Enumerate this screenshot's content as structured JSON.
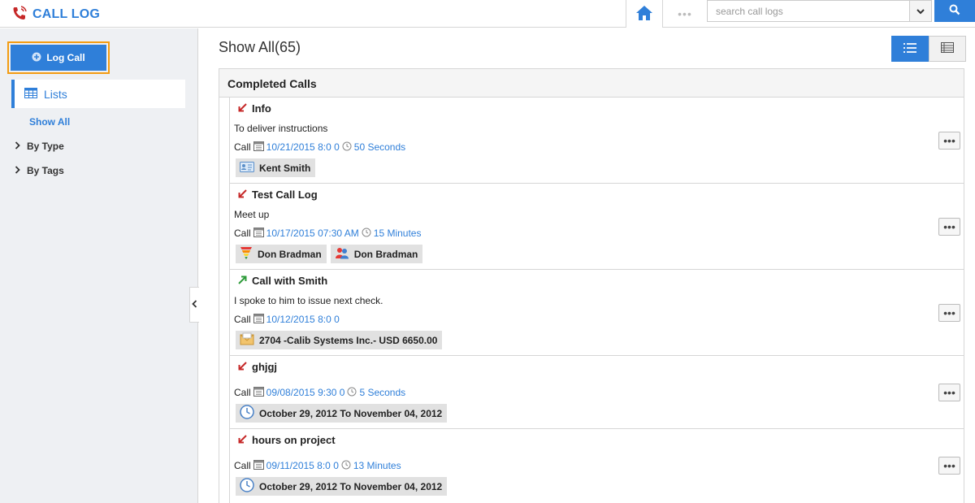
{
  "header": {
    "title": "CALL LOG",
    "search_placeholder": "search call logs",
    "dots": "•••"
  },
  "sidebar": {
    "log_call_label": "Log Call",
    "lists_label": "Lists",
    "show_all_label": "Show All",
    "by_type_label": "By Type",
    "by_tags_label": "By Tags"
  },
  "main": {
    "title": "Show All(65)",
    "panel_title": "Completed Calls",
    "more_label": "•••",
    "rows": [
      {
        "title": "Info",
        "direction": "incoming",
        "description": "To deliver instructions",
        "type": "Call",
        "datetime": "10/21/2015 8:0 0",
        "duration": "50 Seconds",
        "chips": [
          {
            "icon": "contact-card-icon",
            "label": "Kent Smith"
          }
        ]
      },
      {
        "title": "Test Call Log",
        "direction": "incoming",
        "description": "Meet up",
        "type": "Call",
        "datetime": "10/17/2015 07:30 AM",
        "duration": "15 Minutes",
        "chips": [
          {
            "icon": "funnel-icon",
            "label": "Don Bradman"
          },
          {
            "icon": "people-icon",
            "label": "Don Bradman"
          }
        ]
      },
      {
        "title": "Call with Smith",
        "direction": "outgoing",
        "description": "I spoke to him to issue next check.",
        "type": "Call",
        "datetime": "10/12/2015 8:0 0",
        "duration": "",
        "chips": [
          {
            "icon": "invoice-icon",
            "label": "2704 -Calib Systems Inc.- USD 6650.00"
          }
        ]
      },
      {
        "title": "ghjgj",
        "direction": "incoming",
        "description": "",
        "type": "Call",
        "datetime": "09/08/2015 9:30 0",
        "duration": "5 Seconds",
        "chips": [
          {
            "icon": "clock-icon",
            "label": "October 29, 2012 To November 04, 2012"
          }
        ]
      },
      {
        "title": "hours on project",
        "direction": "incoming",
        "description": "",
        "type": "Call",
        "datetime": "09/11/2015 8:0 0",
        "duration": "13 Minutes",
        "chips": [
          {
            "icon": "clock-icon",
            "label": "October 29, 2012 To November 04, 2012"
          }
        ]
      }
    ]
  },
  "colors": {
    "accent": "#2f7fd9",
    "highlight": "#f39c12",
    "incoming": "#c62828",
    "outgoing": "#2e9b3a"
  }
}
